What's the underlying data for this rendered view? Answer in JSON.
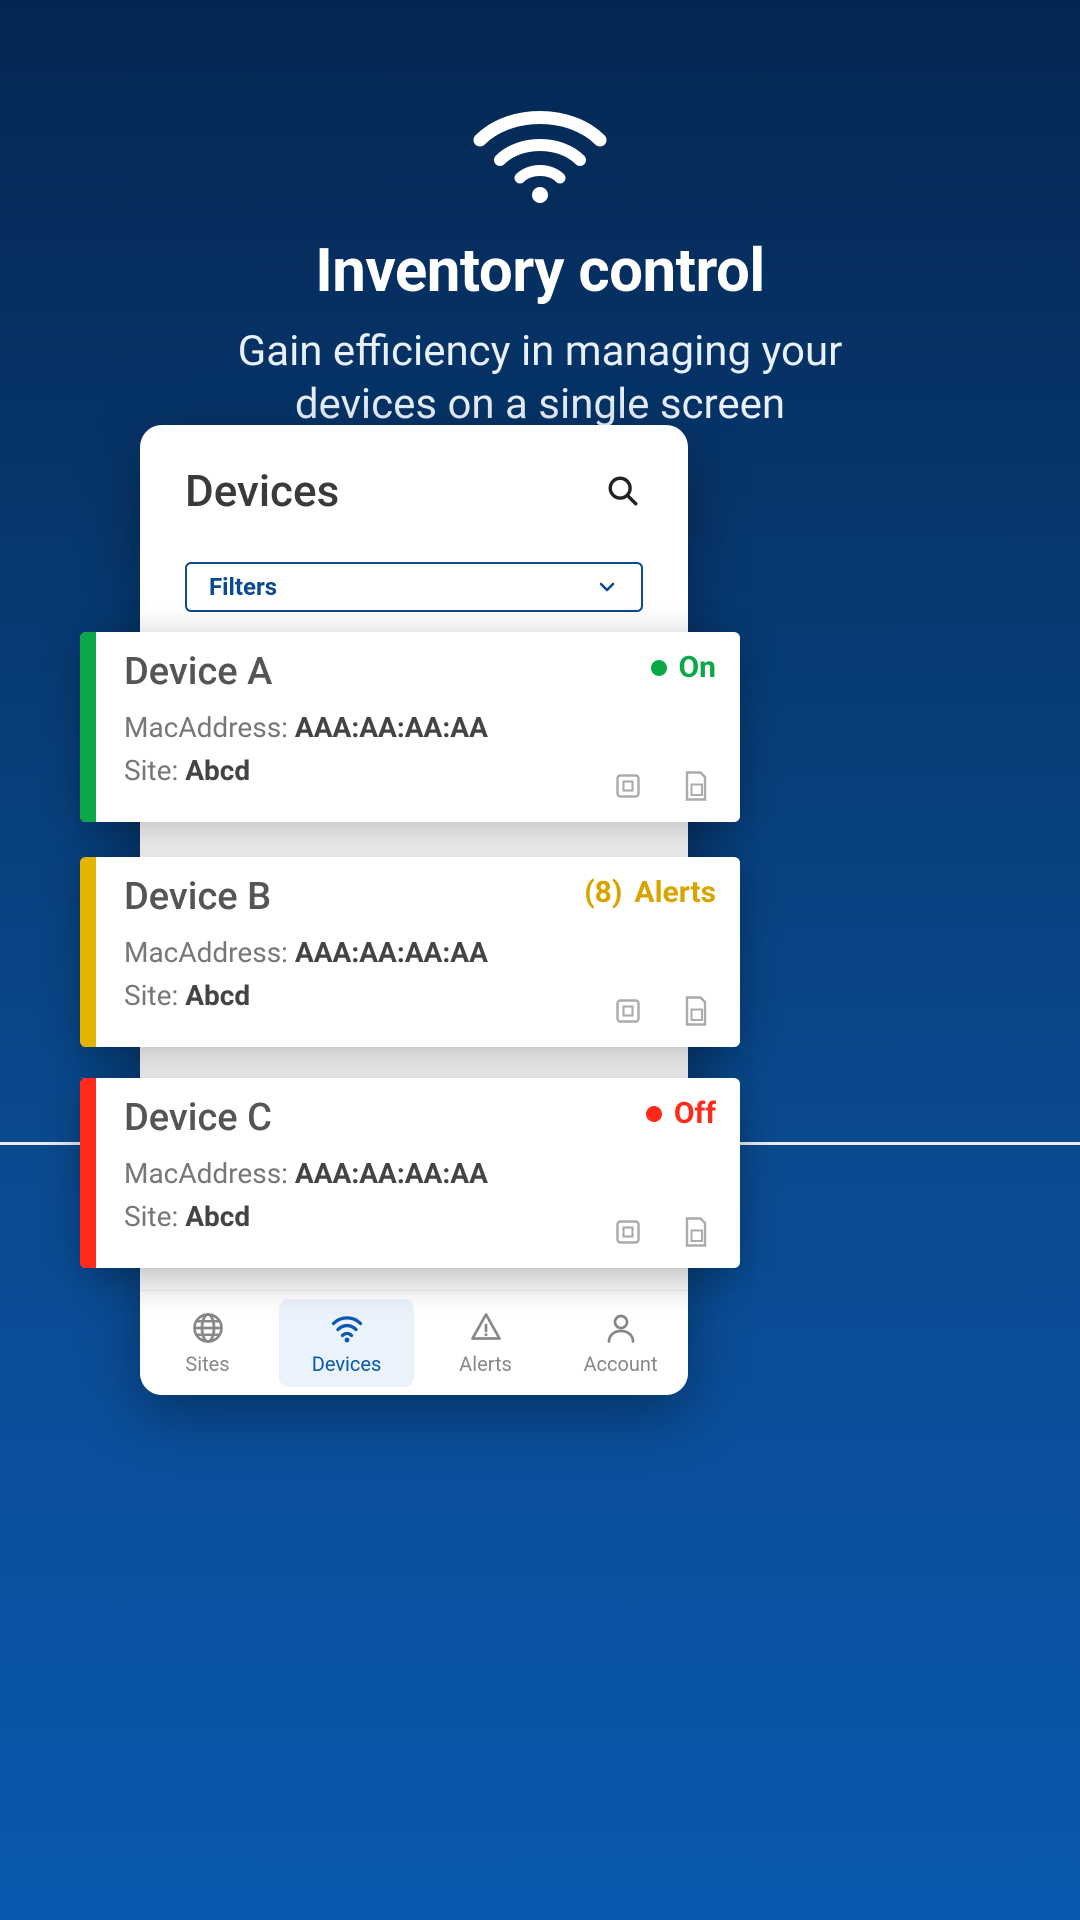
{
  "hero": {
    "title": "Inventory control",
    "subtitle_line1": "Gain efficiency in managing your",
    "subtitle_line2": "devices on a single screen"
  },
  "screen": {
    "title": "Devices",
    "filters_label": "Filters"
  },
  "devices": [
    {
      "name": "Device A",
      "mac_label": "MacAddress:",
      "mac_value": "AAA:AA:AA:AA",
      "site_label": "Site:",
      "site_value": "Abcd",
      "status_text": "On",
      "status_class": "green",
      "stripe_class": "stripe-green",
      "show_dot": true,
      "alert_count": ""
    },
    {
      "name": "Device B",
      "mac_label": "MacAddress:",
      "mac_value": "AAA:AA:AA:AA",
      "site_label": "Site:",
      "site_value": "Abcd",
      "status_text": "Alerts",
      "status_class": "yellow",
      "stripe_class": "stripe-yellow",
      "show_dot": false,
      "alert_count": "(8)"
    },
    {
      "name": "Device C",
      "mac_label": "MacAddress:",
      "mac_value": "AAA:AA:AA:AA",
      "site_label": "Site:",
      "site_value": "Abcd",
      "status_text": "Off",
      "status_class": "red",
      "stripe_class": "stripe-red",
      "show_dot": true,
      "alert_count": ""
    }
  ],
  "nav": {
    "items": [
      {
        "label": "Sites",
        "icon": "globe",
        "active": false
      },
      {
        "label": "Devices",
        "icon": "wifi",
        "active": true
      },
      {
        "label": "Alerts",
        "icon": "alert",
        "active": false
      },
      {
        "label": "Account",
        "icon": "person",
        "active": false
      }
    ]
  }
}
